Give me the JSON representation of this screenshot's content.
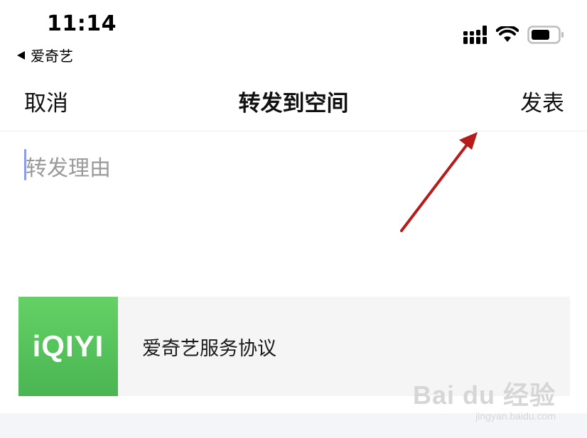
{
  "status_bar": {
    "time": "11:14",
    "back_app": "爱奇艺",
    "icons": [
      "cellular-signal-icon",
      "wifi-icon",
      "battery-icon"
    ]
  },
  "nav": {
    "cancel_label": "取消",
    "title": "转发到空间",
    "publish_label": "发表"
  },
  "reason_input": {
    "placeholder": "转发理由",
    "value": ""
  },
  "share_card": {
    "thumb_text": "iQIYI",
    "title": "爱奇艺服务协议",
    "thumb_color": "#5cc860"
  },
  "watermark": {
    "main": "Bai du 经验",
    "sub": "jingyan.baidu.com"
  },
  "colors": {
    "annotation_arrow": "#b71c1c",
    "caret": "#8a9bf0"
  }
}
